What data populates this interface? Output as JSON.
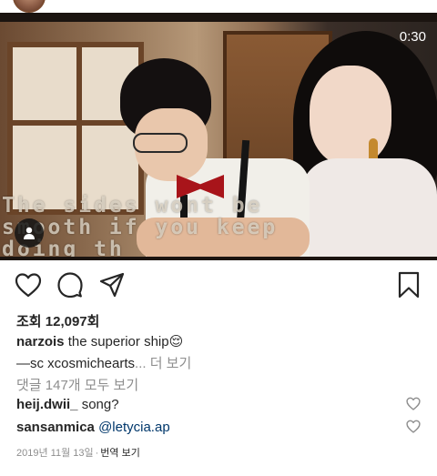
{
  "video": {
    "duration": "0:30",
    "subtitle": "The sides wont be\nsmooth if you keep\ndoing th"
  },
  "icons": {
    "like": "heart-icon",
    "comment": "comment-icon",
    "share": "paper-plane-icon",
    "save": "bookmark-icon",
    "sound": "person-icon"
  },
  "post": {
    "views": "조회 12,097회",
    "author": "narzois",
    "caption_text": "the superior ship",
    "caption_emoji": "😌",
    "caption_line2": "—sc xcosmichearts",
    "ellipsis": "...",
    "more": "더 보기",
    "view_all_comments": "댓글 147개 모두 보기"
  },
  "comments": [
    {
      "user": "heij.dwii_",
      "text": "song?"
    },
    {
      "user": "sansanmica",
      "text": "@letycia.ap"
    }
  ],
  "footer": {
    "date": "2019년 11월 13일",
    "separator": "·",
    "translate": "번역 보기"
  },
  "colors": {
    "text": "#262626",
    "muted": "#8e8e8e",
    "mention": "#00376b"
  }
}
